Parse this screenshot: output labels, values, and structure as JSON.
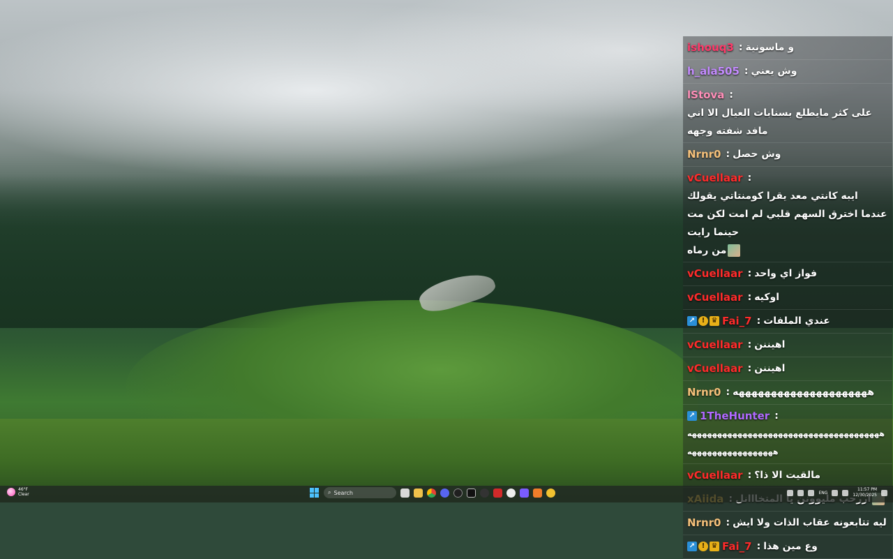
{
  "chat": {
    "messages": [
      {
        "user": "ishouq3",
        "color": "#ff3a6a",
        "text": "و ماسونية"
      },
      {
        "user": "h_ala505",
        "color": "#c48bff",
        "text": "وش يعني"
      },
      {
        "user": "lStova",
        "color": "#ff8fb8",
        "text": "على كثر مايطلع بسنابات العيال الا اني",
        "text2": "مافد شفته وجهه"
      },
      {
        "user": "Nrnr0",
        "color": "#f5c07a",
        "text": "وش حصل"
      },
      {
        "user": "vCuellaar",
        "color": "#ff2b2b",
        "text": "ايبه كانتي معد يقرا كومنتاتي يقولك",
        "text2": "عندما اخترق السهم قلبي لم امت لكن مت حينما رايت",
        "text3": "من رماه"
      },
      {
        "user": "vCuellaar",
        "color": "#ff2b2b",
        "text": "فواز اي واحد"
      },
      {
        "user": "vCuellaar",
        "color": "#ff2b2b",
        "text": "اوكيه"
      },
      {
        "user": "Fai_7",
        "color": "#ff2b2b",
        "text": "عندي الملفات",
        "badges": true
      },
      {
        "user": "vCuellaar",
        "color": "#ff2b2b",
        "text": "اهيننن"
      },
      {
        "user": "vCuellaar",
        "color": "#ff2b2b",
        "text": "اهيننن"
      },
      {
        "user": "Nrnr0",
        "color": "#f5c07a",
        "text": "هههههههههههههههههههههه"
      },
      {
        "user": "1TheHunter",
        "color": "#b069ff",
        "text": "",
        "text2": "ههههههههههههههههههههههههههههههههههههههه",
        "text3": "هههههههههههههههههه",
        "badge_single": true
      },
      {
        "user": "vCuellaar",
        "color": "#ff2b2b",
        "text": "مالقيت الا ذا؟"
      },
      {
        "user": "xAiida",
        "color": "#ffd24a",
        "text": "اررحب مليوونن يا المتخااانل"
      },
      {
        "user": "Nrnr0",
        "color": "#f5c07a",
        "text": "ليه تتابعونه عقاب الذات ولا ايش"
      },
      {
        "user": "Fai_7",
        "color": "#ff2b2b",
        "text": "وع مين هذا",
        "badges": true
      }
    ]
  },
  "taskbar": {
    "weather_temp": "46°F",
    "weather_desc": "Clear",
    "search_placeholder": "Search",
    "lang": "ENG",
    "time": "11:57 PM",
    "date": "12/30/2025"
  },
  "icons": {
    "start": "windows-start-icon",
    "search": "search-icon"
  }
}
